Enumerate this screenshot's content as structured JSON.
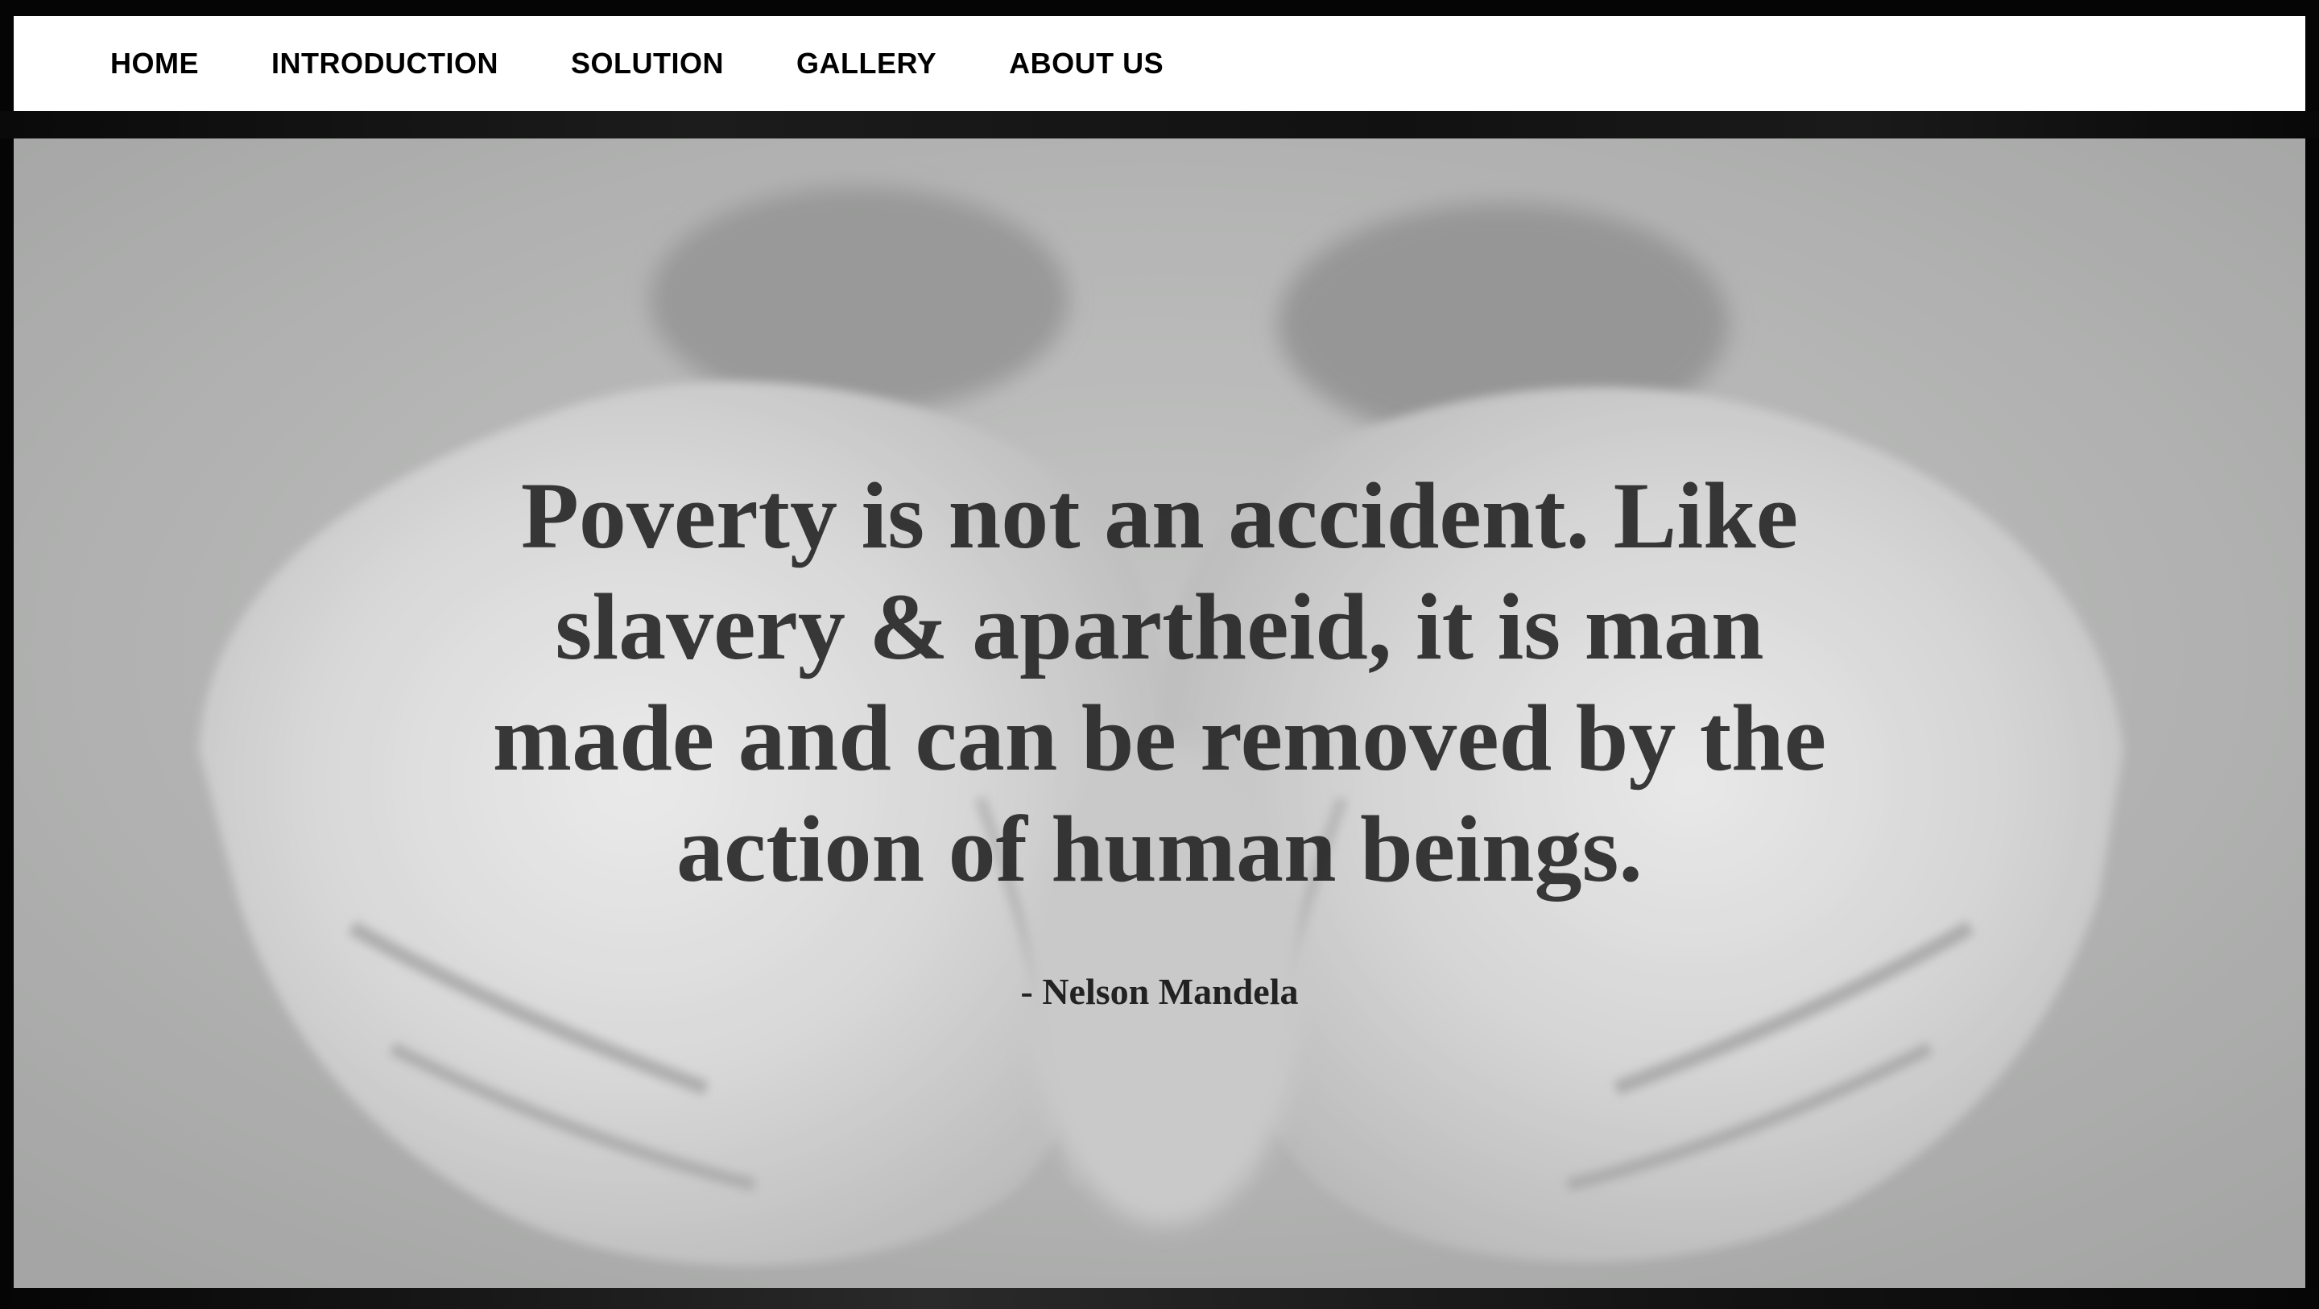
{
  "nav": {
    "items": [
      {
        "label": "HOME"
      },
      {
        "label": "INTRODUCTION"
      },
      {
        "label": "SOLUTION"
      },
      {
        "label": "GALLERY"
      },
      {
        "label": "ABOUT US"
      }
    ]
  },
  "hero": {
    "image": "cupped-hands-photo",
    "quote": "Poverty is not an accident. Like slavery & apartheid, it is man made and can be removed by the action of human beings.",
    "author": "- Nelson Mandela"
  },
  "colors": {
    "nav_background": "#ffffff",
    "nav_text": "#000000",
    "frame": "#050505",
    "hero_tint": "#a9aaa9",
    "quote_text": "#1c1c1c"
  }
}
